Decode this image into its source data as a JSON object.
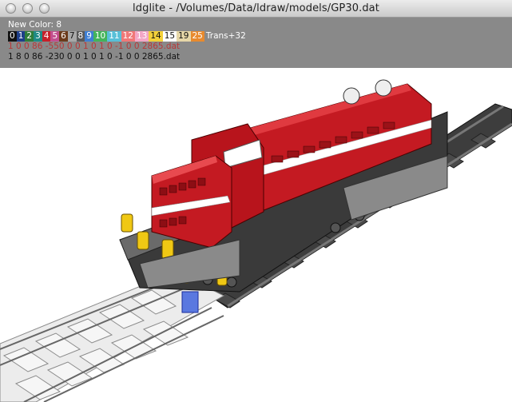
{
  "window": {
    "title": "ldglite - /Volumes/Data/ldraw/models/GP30.dat"
  },
  "info": {
    "new_color": "New Color: 8",
    "palette": [
      {
        "label": "0",
        "bg": "#111111",
        "fg": "#ffffff"
      },
      {
        "label": "1",
        "bg": "#1e3f8a",
        "fg": "#ffffff"
      },
      {
        "label": "2",
        "bg": "#2e7d3a",
        "fg": "#ffffff"
      },
      {
        "label": "3",
        "bg": "#1f8a86",
        "fg": "#ffffff"
      },
      {
        "label": "4",
        "bg": "#c8202a",
        "fg": "#ffffff"
      },
      {
        "label": "5",
        "bg": "#c24e8e",
        "fg": "#ffffff"
      },
      {
        "label": "6",
        "bg": "#6b3b1c",
        "fg": "#ffffff"
      },
      {
        "label": "7",
        "bg": "#a8a8a8",
        "fg": "#111111"
      },
      {
        "label": "8",
        "bg": "#5a5a5a",
        "fg": "#ffffff"
      },
      {
        "label": "9",
        "bg": "#3e7fd4",
        "fg": "#ffffff"
      },
      {
        "label": "10",
        "bg": "#43b45a",
        "fg": "#ffffff"
      },
      {
        "label": "11",
        "bg": "#58c0d8",
        "fg": "#ffffff"
      },
      {
        "label": "12",
        "bg": "#f07878",
        "fg": "#ffffff"
      },
      {
        "label": "13",
        "bg": "#f3a6c6",
        "fg": "#ffffff"
      },
      {
        "label": "14",
        "bg": "#f3d03a",
        "fg": "#111111"
      },
      {
        "label": "15",
        "bg": "#ffffff",
        "fg": "#111111"
      },
      {
        "label": "19",
        "bg": "#e6d7a8",
        "fg": "#111111"
      },
      {
        "label": "25",
        "bg": "#e88a2e",
        "fg": "#ffffff"
      }
    ],
    "trans_label": "Trans+32",
    "line1": "1 0 0 86 -550 0 0 1 0 1 0 -1 0 0 2865.dat",
    "line2": "1 8 0 86 -230 0 0 1 0 1 0 -1 0 0 2865.dat"
  },
  "scene": {
    "model_body_color": "#c41a22",
    "model_stripe_color": "#ffffff",
    "model_base_color": "#3a3a3a",
    "track_color": "#5a5a5a",
    "selected_part_color": "#d9d9d9",
    "accent_yellow": "#f0c814",
    "accent_blue": "#2a4fd0"
  }
}
